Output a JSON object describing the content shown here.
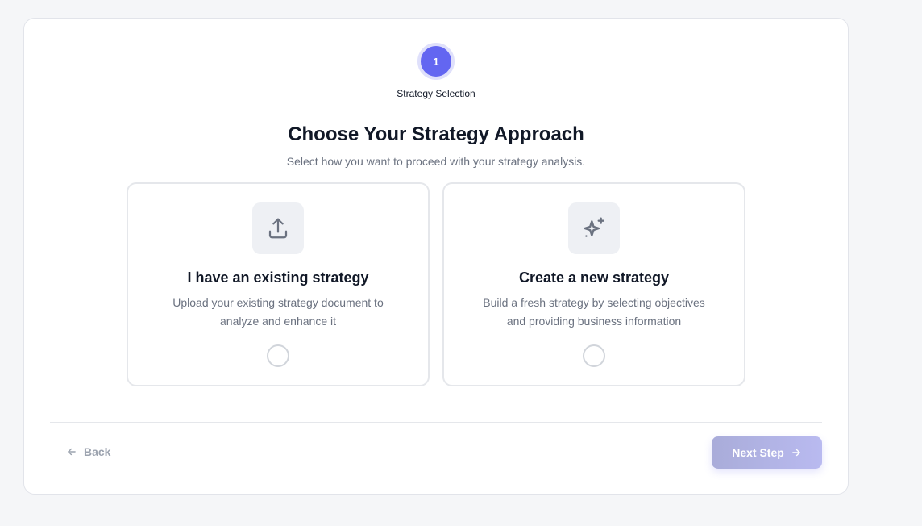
{
  "stepper": {
    "current_step_number": "1",
    "current_step_label": "Strategy Selection"
  },
  "page": {
    "title": "Choose Your Strategy Approach",
    "subtitle": "Select how you want to proceed with your strategy analysis."
  },
  "options": [
    {
      "icon": "upload-icon",
      "title": "I have an existing strategy",
      "description": "Upload your existing strategy document to analyze and enhance it",
      "selected": false
    },
    {
      "icon": "sparkles-icon",
      "title": "Create a new strategy",
      "description": "Build a fresh strategy by selecting objectives and providing business information",
      "selected": false
    }
  ],
  "footer": {
    "back_label": "Back",
    "next_label": "Next Step"
  },
  "colors": {
    "accent": "#6366f1",
    "next_disabled_start": "#a9acd9",
    "next_disabled_end": "#b9baf0"
  }
}
